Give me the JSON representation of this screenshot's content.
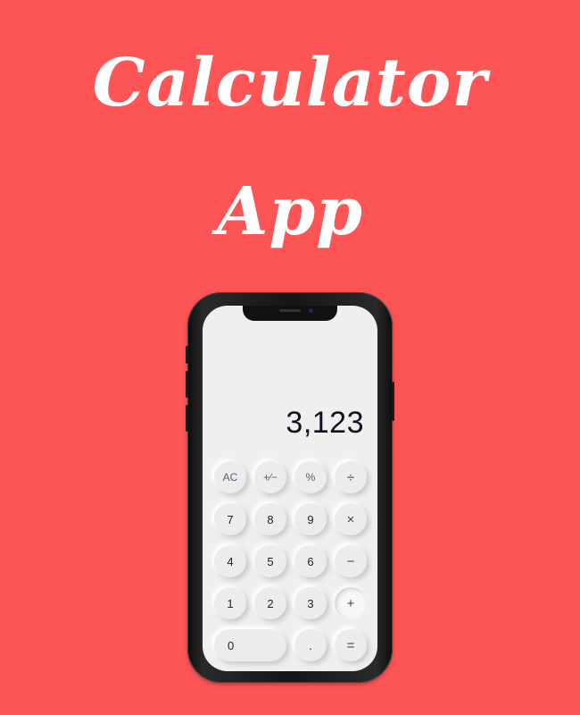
{
  "title": {
    "line1": "Calculator",
    "line2": "App"
  },
  "calculator": {
    "display": "3,123",
    "keys": {
      "ac": "AC",
      "plus_minus": "+∕−",
      "percent": "%",
      "divide": "÷",
      "seven": "7",
      "eight": "8",
      "nine": "9",
      "multiply": "×",
      "four": "4",
      "five": "5",
      "six": "6",
      "minus": "−",
      "one": "1",
      "two": "2",
      "three": "3",
      "plus": "+",
      "zero": "0",
      "decimal": ".",
      "equals": "="
    }
  },
  "colors": {
    "background": "#fd5556",
    "title": "#ffffff",
    "screen": "#efefef",
    "phone_frame": "#151515",
    "display_text": "#121220"
  }
}
